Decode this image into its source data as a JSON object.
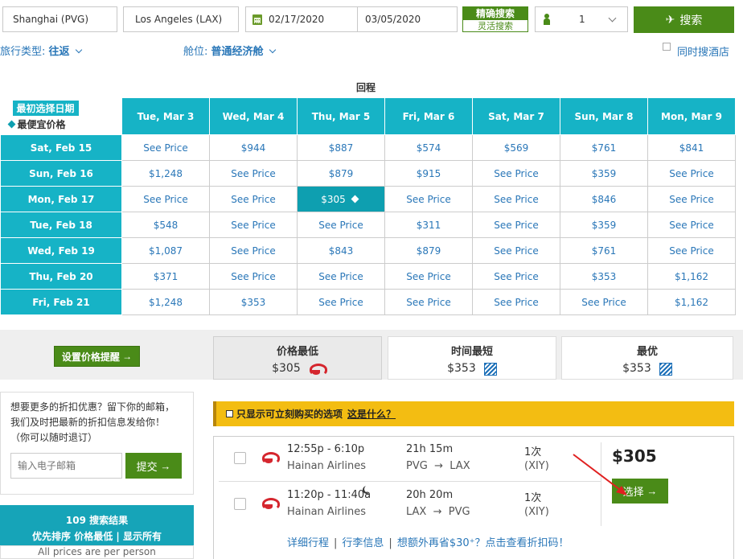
{
  "search": {
    "origin": "Shanghai (PVG)",
    "destination": "Los Angeles (LAX)",
    "depart_date": "02/17/2020",
    "return_date": "03/05/2020",
    "mode_exact": "精确搜索",
    "mode_flex": "灵活搜索",
    "passengers": "1",
    "search_button": "搜索"
  },
  "options": {
    "trip_type_label": "旅行类型:",
    "trip_type_value": "往返",
    "cabin_label": "舱位:",
    "cabin_value": "普通经济舱",
    "hotel_label": "同时搜酒店"
  },
  "matrix": {
    "return_label": "回程",
    "corner_badge": "最初选择日期",
    "corner_cheapest": "最便宜价格",
    "columns": [
      "Tue, Mar 3",
      "Wed, Mar 4",
      "Thu, Mar 5",
      "Fri, Mar 6",
      "Sat, Mar 7",
      "Sun, Mar 8",
      "Mon, Mar 9"
    ],
    "rows": [
      {
        "date": "Sat, Feb 15",
        "cells": [
          "See Price",
          "$944",
          "$887",
          "$574",
          "$569",
          "$761",
          "$841"
        ]
      },
      {
        "date": "Sun, Feb 16",
        "cells": [
          "$1,248",
          "See Price",
          "$879",
          "$915",
          "See Price",
          "$359",
          "See Price"
        ]
      },
      {
        "date": "Mon, Feb 17",
        "cells": [
          "See Price",
          "See Price",
          "$305",
          "See Price",
          "See Price",
          "$846",
          "See Price"
        ]
      },
      {
        "date": "Tue, Feb 18",
        "cells": [
          "$548",
          "See Price",
          "See Price",
          "$311",
          "See Price",
          "$359",
          "See Price"
        ]
      },
      {
        "date": "Wed, Feb 19",
        "cells": [
          "$1,087",
          "See Price",
          "$843",
          "$879",
          "See Price",
          "$761",
          "See Price"
        ]
      },
      {
        "date": "Thu, Feb 20",
        "cells": [
          "$371",
          "See Price",
          "See Price",
          "See Price",
          "See Price",
          "$353",
          "$1,162"
        ]
      },
      {
        "date": "Fri, Feb 21",
        "cells": [
          "$1,248",
          "$353",
          "See Price",
          "See Price",
          "See Price",
          "See Price",
          "$1,162"
        ]
      }
    ],
    "selected": {
      "row": 2,
      "col": 2
    }
  },
  "sort": {
    "alert_button": "设置价格提醒",
    "tabs": [
      {
        "label": "价格最低",
        "price": "$305",
        "airline_icon": "hainan-logo-icon"
      },
      {
        "label": "时间最短",
        "price": "$353",
        "airline_icon": "united-logo-icon"
      },
      {
        "label": "最优",
        "price": "$353",
        "airline_icon": "united-logo-icon"
      }
    ]
  },
  "promo": {
    "line1": "想要更多的折扣优惠？留下你的邮箱，",
    "line2": "我们及时把最新的折扣信息发给你！",
    "line3": "（你可以随时退订）",
    "email_placeholder": "输入电子邮箱",
    "submit_button": "提交"
  },
  "results": {
    "count": "109 搜索结果",
    "sort_line": "优先排序 价格最低 | 显示所有",
    "note": "All prices are per person"
  },
  "filter": {
    "label": "只显示可立刻购买的选项",
    "what_link": "这是什么？"
  },
  "result_card": {
    "legs": [
      {
        "time": "12:55p - 6:10p",
        "airline": "Hainan Airlines",
        "duration": "21h 15m",
        "route_from": "PVG",
        "route_to": "LAX",
        "stops": "1次",
        "stop_airport": "(XIY)"
      },
      {
        "time": "11:20p - 11:40a",
        "airline": "Hainan Airlines",
        "duration": "20h 20m",
        "route_from": "LAX",
        "route_to": "PVG",
        "stops": "1次",
        "stop_airport": "(XIY)"
      }
    ],
    "price": "$305",
    "select_button": "选择",
    "link_details": "详细行程",
    "link_baggage": "行李信息",
    "link_promo": "想额外再省$30⁺？点击查看折扣码！"
  },
  "colors": {
    "accent_green": "#4a8b18",
    "matrix_teal": "#16b3c6",
    "link_blue": "#2a77b8",
    "filter_yellow": "#f3bd12"
  }
}
